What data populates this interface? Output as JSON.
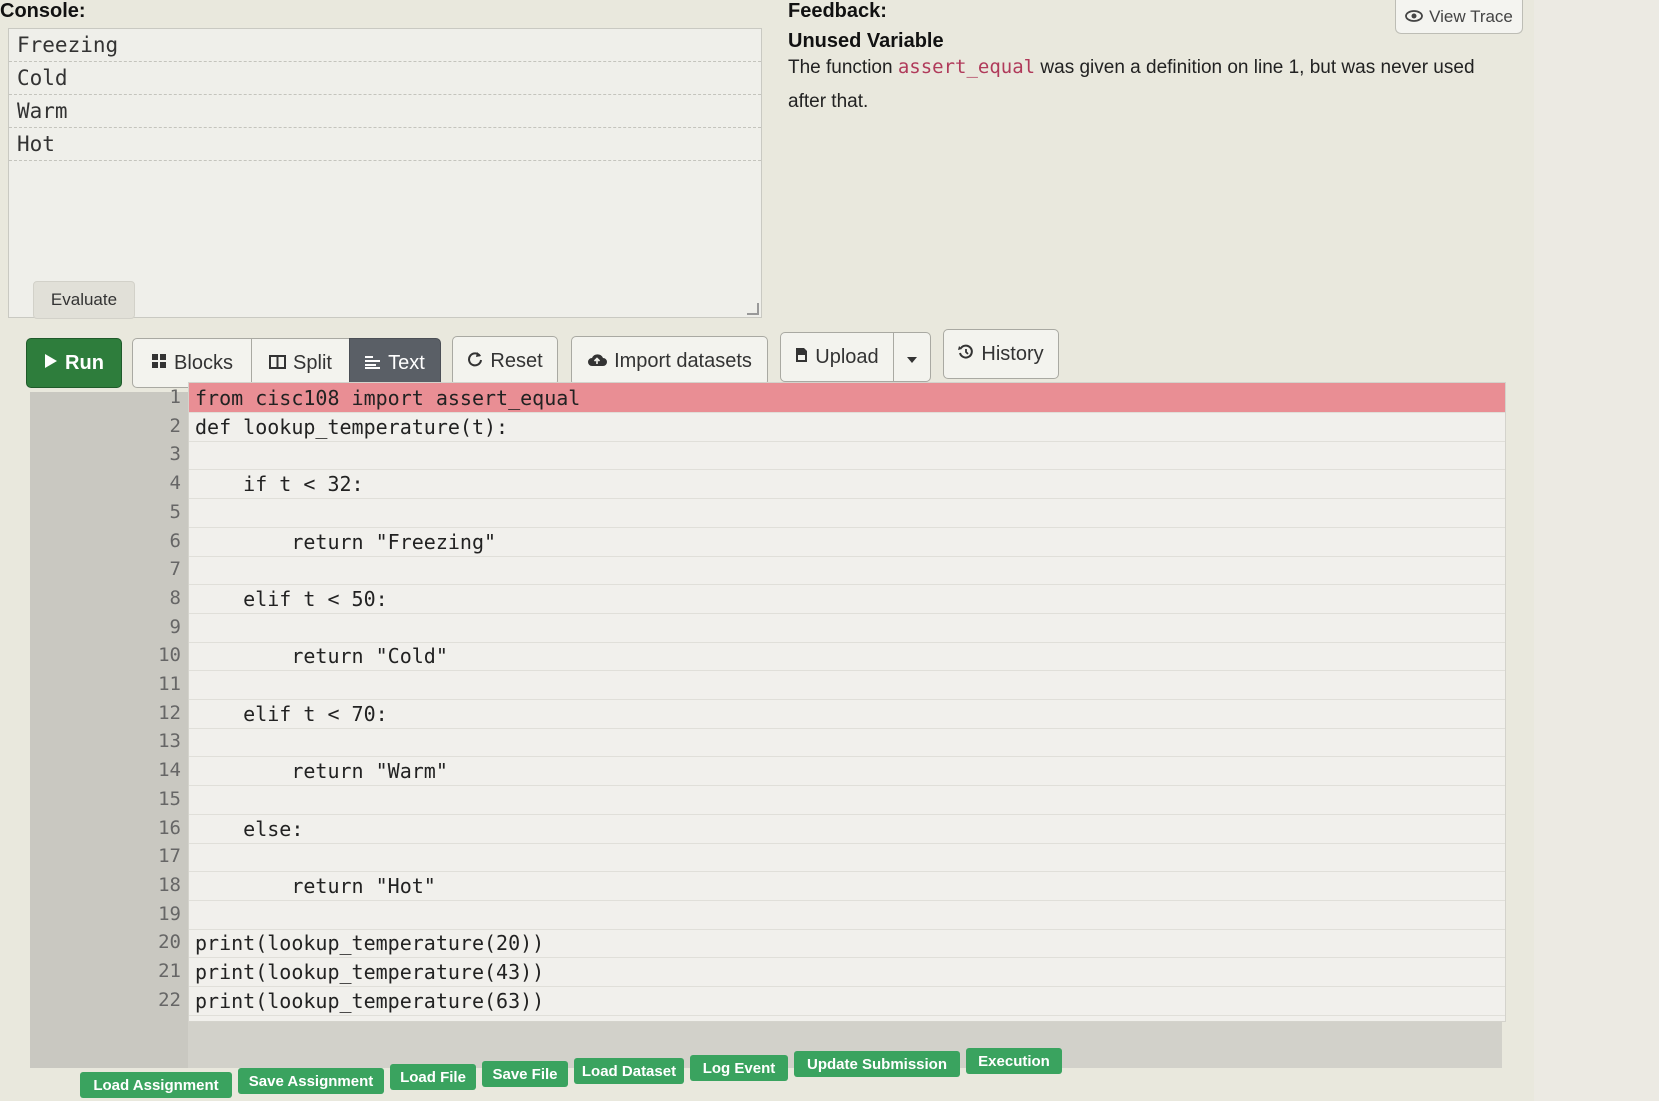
{
  "console": {
    "label": "Console:",
    "lines": [
      "Freezing",
      "Cold",
      "Warm",
      "Hot"
    ],
    "evaluate_label": "Evaluate"
  },
  "feedback": {
    "label": "Feedback:",
    "title": "Unused Variable",
    "message_prefix": "The function ",
    "message_code": "assert_equal",
    "message_suffix": " was given a definition on line 1, but was never used after that.",
    "view_trace_label": "View Trace"
  },
  "toolbar": {
    "run_label": "Run",
    "blocks_label": "Blocks",
    "split_label": "Split",
    "text_label": "Text",
    "reset_label": "Reset",
    "import_label": "Import datasets",
    "upload_label": "Upload",
    "history_label": "History"
  },
  "editor": {
    "lines": [
      {
        "n": "1",
        "text": "from cisc108 import assert_equal",
        "error": true
      },
      {
        "n": "2",
        "text": "def lookup_temperature(t):"
      },
      {
        "n": "3",
        "text": ""
      },
      {
        "n": "4",
        "text": "    if t < 32:"
      },
      {
        "n": "5",
        "text": ""
      },
      {
        "n": "6",
        "text": "        return \"Freezing\""
      },
      {
        "n": "7",
        "text": ""
      },
      {
        "n": "8",
        "text": "    elif t < 50:"
      },
      {
        "n": "9",
        "text": ""
      },
      {
        "n": "10",
        "text": "        return \"Cold\""
      },
      {
        "n": "11",
        "text": ""
      },
      {
        "n": "12",
        "text": "    elif t < 70:"
      },
      {
        "n": "13",
        "text": ""
      },
      {
        "n": "14",
        "text": "        return \"Warm\""
      },
      {
        "n": "15",
        "text": ""
      },
      {
        "n": "16",
        "text": "    else:"
      },
      {
        "n": "17",
        "text": ""
      },
      {
        "n": "18",
        "text": "        return \"Hot\""
      },
      {
        "n": "19",
        "text": ""
      },
      {
        "n": "20",
        "text": "print(lookup_temperature(20))"
      },
      {
        "n": "21",
        "text": "print(lookup_temperature(43))"
      },
      {
        "n": "22",
        "text": "print(lookup_temperature(63))"
      }
    ]
  },
  "bottom_buttons": [
    "Load Assignment",
    "Save Assignment",
    "Load File",
    "Save File",
    "Load Dataset",
    "Log Event",
    "Update Submission",
    "Execution"
  ],
  "colors": {
    "run_green": "#2e7d3c",
    "error_line": "#e98e94",
    "bottom_button_green": "#3aa35f"
  },
  "icons": {
    "run": "play-icon",
    "blocks": "grid-icon",
    "split": "columns-icon",
    "text": "align-left-icon",
    "reset": "refresh-icon",
    "import": "cloud-upload-icon",
    "upload": "file-icon",
    "history": "history-icon",
    "view_trace": "eye-icon"
  }
}
